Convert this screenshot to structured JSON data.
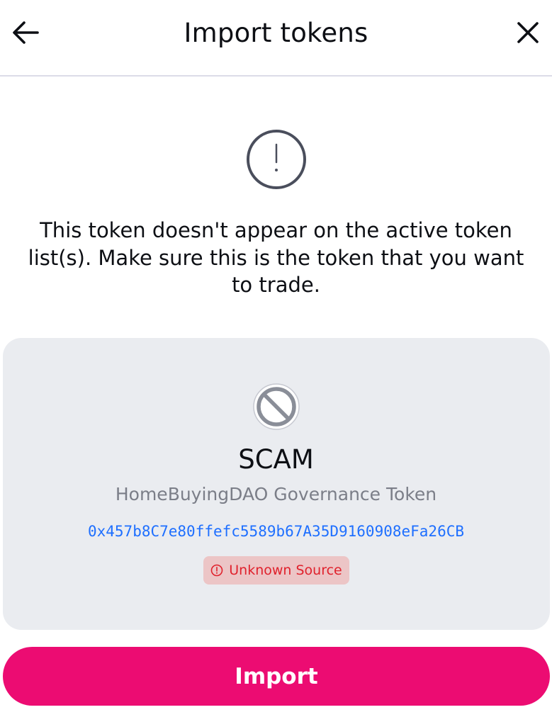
{
  "header": {
    "title": "Import tokens",
    "back_icon": "arrow-left-icon",
    "close_icon": "close-icon"
  },
  "warning": {
    "icon": "alert-circle-icon",
    "message": "This token doesn't appear on the active token list(s). Make sure this is the token that you want to trade."
  },
  "token": {
    "icon": "blocked-token-icon",
    "symbol": "SCAM",
    "name": "HomeBuyingDAO Governance Token",
    "address": "0x457b8C7e80ffefc5589b67A35D9160908eFa26CB",
    "badge": {
      "icon": "alert-circle-icon",
      "label": "Unknown Source"
    }
  },
  "actions": {
    "import_label": "Import"
  },
  "colors": {
    "accent": "#ec0c72",
    "link": "#1e6fff",
    "danger": "#e0212c",
    "danger_bg": "#ecc5c6",
    "card_bg": "#eaecf0",
    "muted_text": "#7b7e88"
  }
}
